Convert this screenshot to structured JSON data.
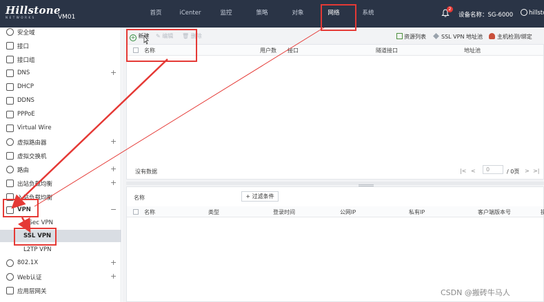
{
  "header": {
    "brand": "Hillstone",
    "brand_sub": "NETWORKS",
    "vm": "VM01",
    "nav": [
      "首页",
      "iCenter",
      "监控",
      "策略",
      "对象",
      "网络",
      "系统"
    ],
    "active_nav": "网络",
    "notification_count": "2",
    "device_name": "设备名称：SG-6000",
    "user": "hillsto"
  },
  "sidebar": {
    "items": [
      {
        "label": "安全域",
        "icon": "zone-icon"
      },
      {
        "label": "接口",
        "icon": "interface-icon"
      },
      {
        "label": "接口组",
        "icon": "interface-group-icon"
      },
      {
        "label": "DNS",
        "icon": "dns-icon",
        "expand": "+"
      },
      {
        "label": "DHCP",
        "icon": "dhcp-icon"
      },
      {
        "label": "DDNS",
        "icon": "ddns-icon"
      },
      {
        "label": "PPPoE",
        "icon": "pppoe-icon"
      },
      {
        "label": "Virtual Wire",
        "icon": "virtual-wire-icon"
      },
      {
        "label": "虚拟路由器",
        "icon": "virtual-router-icon",
        "expand": "+"
      },
      {
        "label": "虚拟交换机",
        "icon": "virtual-switch-icon"
      },
      {
        "label": "路由",
        "icon": "route-icon",
        "expand": "+"
      },
      {
        "label": "出站负载均衡",
        "icon": "outbound-lb-icon",
        "expand": "+"
      },
      {
        "label": "入站负载均衡",
        "icon": "inbound-lb-icon"
      },
      {
        "label": "VPN",
        "icon": "vpn-icon",
        "expand": "−"
      }
    ],
    "vpn_sub": [
      "IPSec VPN",
      "SSL VPN",
      "L2TP VPN"
    ],
    "selected_sub": "SSL VPN",
    "bottom_items": [
      {
        "label": "802.1X",
        "icon": "wifi-icon",
        "expand": "+"
      },
      {
        "label": "Web认证",
        "icon": "web-auth-icon",
        "expand": "+"
      },
      {
        "label": "应用层网关",
        "icon": "app-gateway-icon"
      }
    ]
  },
  "toolbar": {
    "new_label": "新建",
    "edit_label": "编辑",
    "delete_label": "删除",
    "resource_list": "资源列表",
    "ssl_addr_pool": "SSL VPN 地址池",
    "host_binding": "主机检测/绑定"
  },
  "upper_table": {
    "columns": [
      "名称",
      "用户数",
      "接口",
      "隧道接口",
      "地址池"
    ],
    "empty_text": "没有数据",
    "pager": {
      "first": "|<",
      "prev": "<",
      "page": "0",
      "total": "/ 0页",
      "next": ">",
      "last": ">|"
    }
  },
  "lower_table": {
    "filter_label": "名称",
    "filter_button": "+ 过滤条件",
    "columns": [
      "名称",
      "类型",
      "登录时间",
      "公网IP",
      "私有IP",
      "客户端版本号",
      "操"
    ]
  },
  "watermark": "CSDN @搬砖牛马人",
  "colors": {
    "header_bg": "#2a3446",
    "annotation": "#e53935",
    "selected_bg": "#d9dde3"
  }
}
